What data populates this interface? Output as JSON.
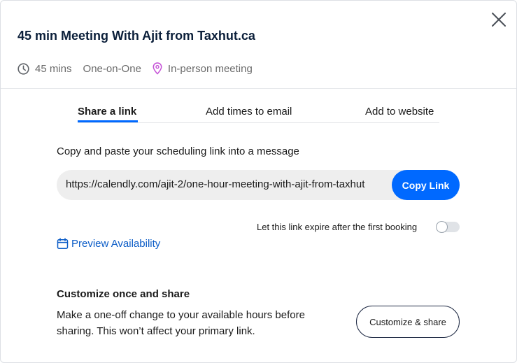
{
  "dialog": {
    "title": "45 min Meeting With Ajit from Taxhut.ca",
    "close_icon": "close-icon"
  },
  "meta": {
    "duration_icon": "clock-icon",
    "duration": "45 mins",
    "meeting_type": "One-on-One",
    "location_icon": "location-pin-icon",
    "location": "In-person meeting"
  },
  "tabs": [
    {
      "label": "Share a link",
      "active": true
    },
    {
      "label": "Add times to email",
      "active": false
    },
    {
      "label": "Add to website",
      "active": false
    }
  ],
  "share": {
    "instruction": "Copy and paste your scheduling link into a message",
    "link": "https://calendly.com/ajit-2/one-hour-meeting-with-ajit-from-taxhut",
    "copy_label": "Copy Link",
    "expire_label": "Let this link expire after the first booking",
    "expire_enabled": false,
    "preview_icon": "calendar-icon",
    "preview_label": "Preview Availability"
  },
  "customize": {
    "title": "Customize once and share",
    "description": "Make a one-off change to your available hours before sharing. This won’t affect your primary link.",
    "button_label": "Customize & share"
  },
  "colors": {
    "accent": "#0069ff",
    "link": "#0b5cc7",
    "title": "#0b1f3a",
    "location_icon": "#c44fd6"
  }
}
